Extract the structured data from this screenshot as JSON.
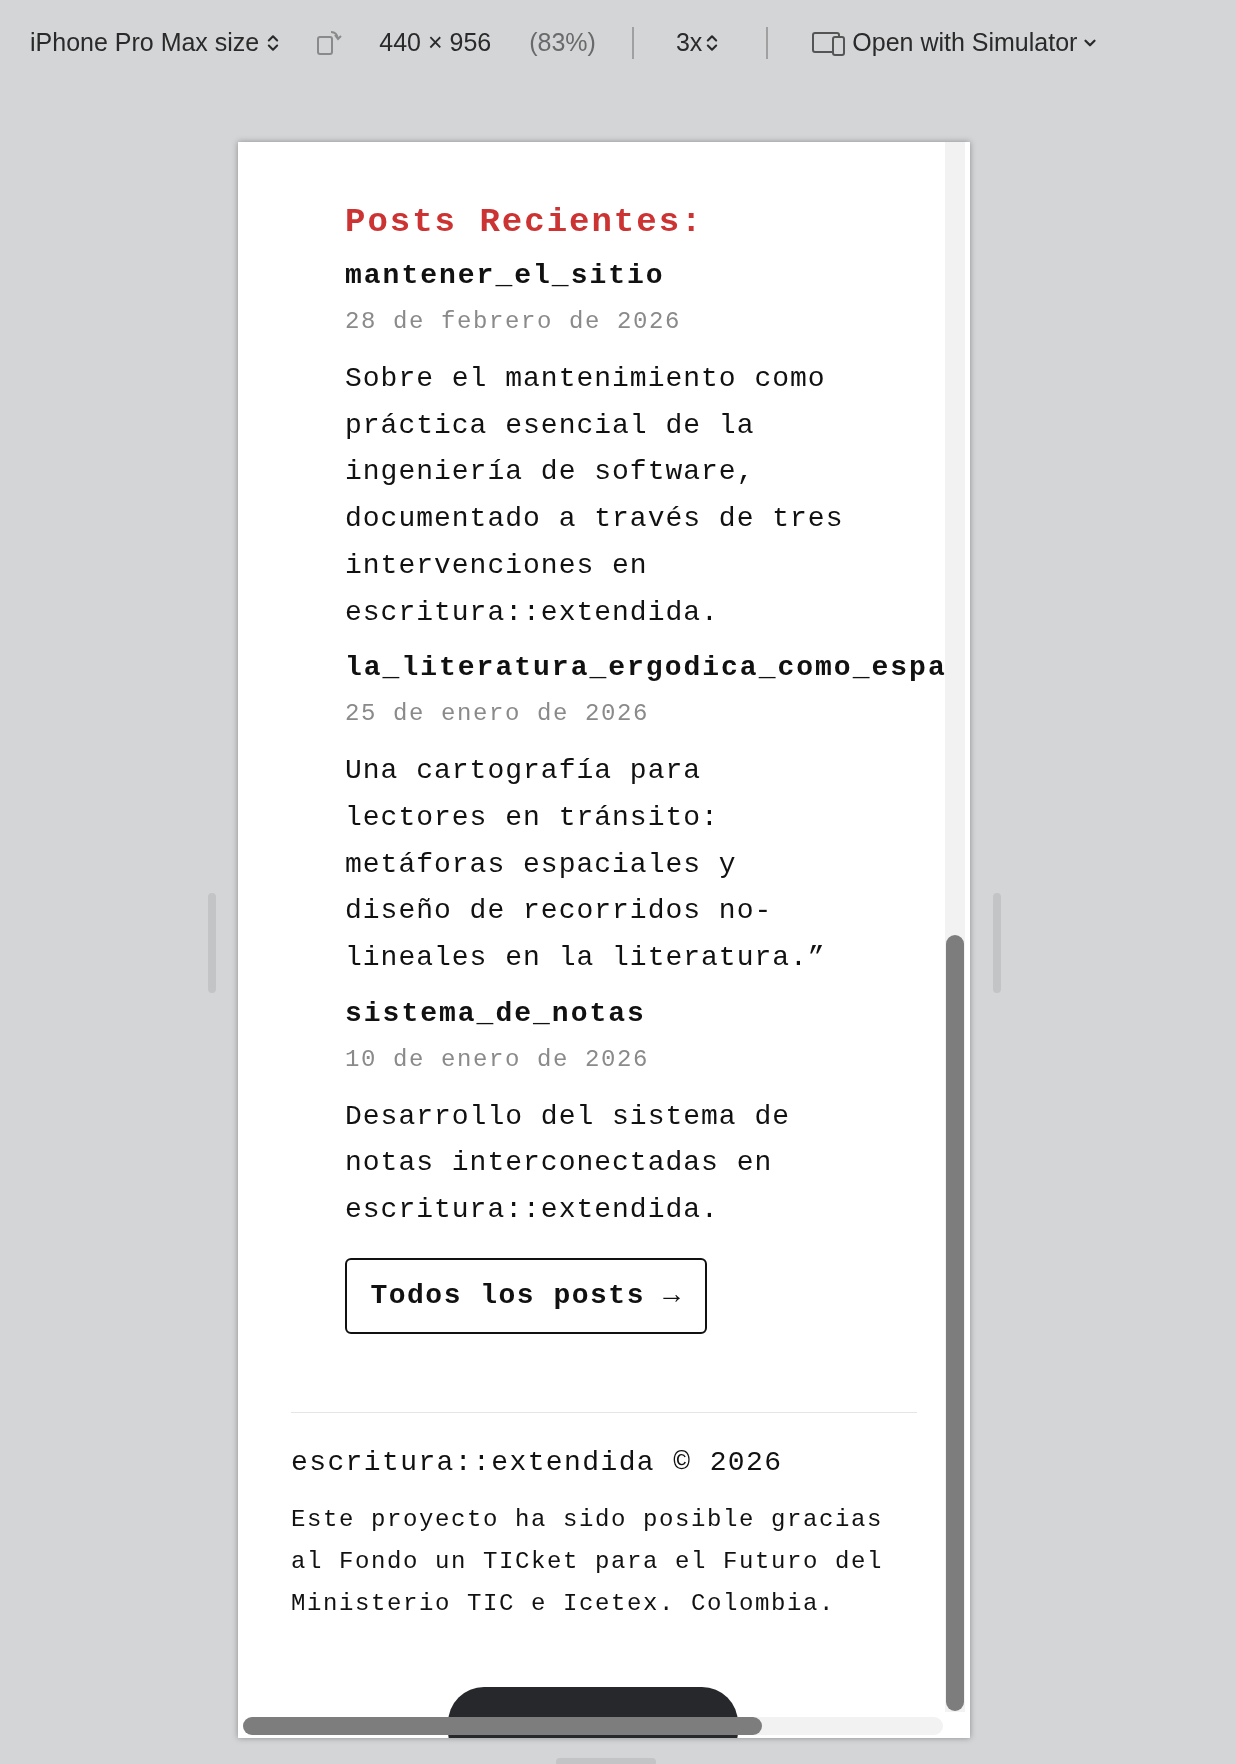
{
  "toolbar": {
    "device": "iPhone Pro Max size",
    "dimensions": "440 × 956",
    "zoom": "(83%)",
    "scale": "3x",
    "open": "Open with Simulator"
  },
  "page": {
    "heading": "Posts Recientes:",
    "posts": [
      {
        "title": "mantener_el_sitio",
        "date": "28 de febrero de 2026",
        "summary": "Sobre el mantenimiento como práctica esencial de la ingeniería de software, documentado a través de tres intervenciones en escritura::extendida."
      },
      {
        "title": "la_literatura_ergodica_como_espa",
        "date": "25 de enero de 2026",
        "summary": "Una cartografía para lectores en tránsito: metáforas espaciales y diseño de recorridos no-lineales en la literatura.”"
      },
      {
        "title": "sistema_de_notas",
        "date": "10 de enero de 2026",
        "summary": "Desarrollo del sistema de notas interconectadas en escritura::extendida."
      }
    ],
    "all_posts_button": "Todos los posts →",
    "footer": {
      "copyright": "escritura::extendida © 2026",
      "note": "Este proyecto ha sido posible gracias al Fondo un TICket para el Futuro del Ministerio TIC e Icetex. Colombia."
    }
  }
}
